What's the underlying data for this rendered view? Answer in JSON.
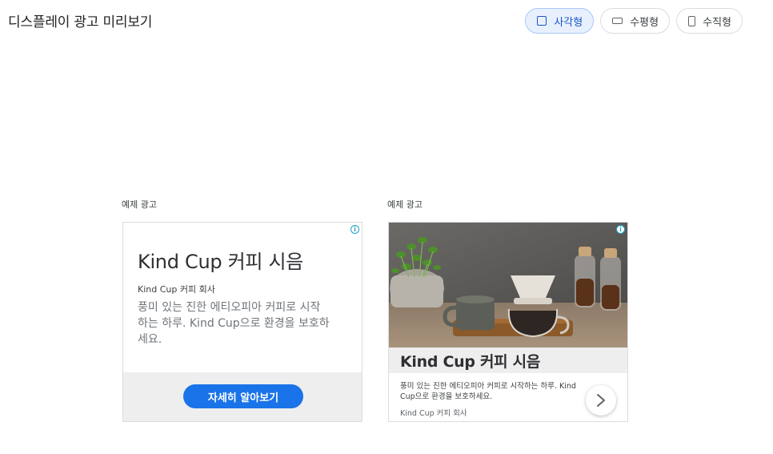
{
  "header": {
    "title": "디스플레이 광고 미리보기",
    "formats": [
      {
        "label": "사각형",
        "icon": "square-icon",
        "active": true
      },
      {
        "label": "수평형",
        "icon": "horizontal-rectangle-icon",
        "active": false
      },
      {
        "label": "수직형",
        "icon": "vertical-rectangle-icon",
        "active": false
      }
    ]
  },
  "ads": [
    {
      "label": "예제 광고",
      "headline": "Kind Cup 커피 시음",
      "business_name": "Kind Cup 커피 회사",
      "description": "풍미 있는 진한 에티오피아 커피로 시작하는 하루. Kind Cup으로 환경을 보호하세요.",
      "cta": "자세히 알아보기",
      "info_icon": "info-icon"
    },
    {
      "label": "예제 광고",
      "headline": "Kind Cup 커피 시음",
      "description": "풍미 있는 진한 에티오피아 커피로 시작하는 하루. Kind Cup으로 환경을 보호하세요.",
      "business_name": "Kind Cup 커피 회사",
      "image": "coffee-pour-over-scene",
      "info_icon": "info-icon",
      "arrow_icon": "chevron-right-icon"
    }
  ],
  "colors": {
    "accent": "#1a73e8",
    "toggle_active_bg": "#e8f0fe",
    "footer_bg": "#eeeeee"
  }
}
